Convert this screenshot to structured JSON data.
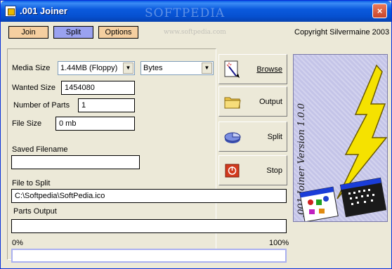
{
  "window": {
    "title": ".001 Joiner",
    "close_label": "×"
  },
  "watermark": {
    "main": "SOFTPEDIA",
    "url": "www.softpedia.com"
  },
  "tabs": {
    "join": "Join",
    "split": "Split",
    "options": "Options"
  },
  "copyright": "Copyright Silvermaine 2003",
  "form": {
    "media_size_label": "Media Size",
    "media_size_value": "1.44MB (Floppy)",
    "unit_value": "Bytes",
    "wanted_size_label": "Wanted Size",
    "wanted_size_value": "1454080",
    "number_of_parts_label": "Number of Parts",
    "number_of_parts_value": "1",
    "file_size_label": "File Size",
    "file_size_value": "0 mb",
    "saved_filename_label": "Saved Filename",
    "saved_filename_value": "",
    "file_to_split_label": "File to Split",
    "file_to_split_value": "C:\\Softpedia\\SoftPedia.ico",
    "parts_output_label": "Parts Output",
    "parts_output_value": ""
  },
  "buttons": {
    "browse": "Browse",
    "output": "Output",
    "split": "Split",
    "stop": "Stop"
  },
  "banner": {
    "text": ".001 Joiner  Version 1.0.0"
  },
  "progress": {
    "min_label": "0%",
    "max_label": "100%",
    "value": 0
  },
  "colors": {
    "title_bar": "#0b5ade",
    "tab_active": "#9aa2f0",
    "tab_inactive": "#f5cfa0",
    "lightning": "#f5e200",
    "stop_red": "#d23a1e"
  },
  "icons": {
    "browse": "magic-wand-icon",
    "output": "folder-icon",
    "split": "pie-chart-icon",
    "stop": "stop-icon"
  }
}
